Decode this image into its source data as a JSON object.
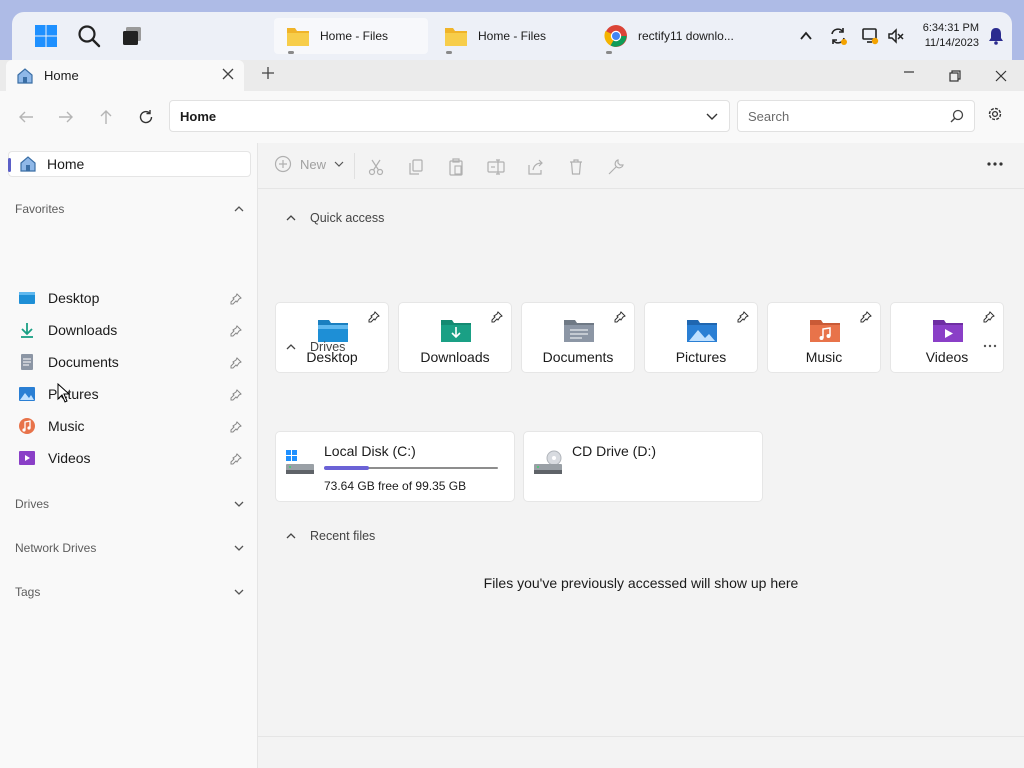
{
  "taskbar": {
    "tasks": [
      {
        "label": "Home - Files",
        "icon": "files-folder-icon"
      },
      {
        "label": "Home - Files",
        "icon": "files-folder-icon"
      },
      {
        "label": "rectify11 downlo...",
        "icon": "chrome-icon"
      }
    ],
    "time": "6:34:31 PM",
    "date": "11/14/2023"
  },
  "window": {
    "tab_title": "Home",
    "address": "Home",
    "search_placeholder": "Search"
  },
  "sidebar": {
    "home_label": "Home",
    "favorites_label": "Favorites",
    "favorites": [
      {
        "label": "Desktop",
        "icon": "desktop-icon"
      },
      {
        "label": "Downloads",
        "icon": "downloads-icon"
      },
      {
        "label": "Documents",
        "icon": "documents-icon"
      },
      {
        "label": "Pictures",
        "icon": "pictures-icon"
      },
      {
        "label": "Music",
        "icon": "music-icon"
      },
      {
        "label": "Videos",
        "icon": "videos-icon"
      }
    ],
    "sections": [
      "Drives",
      "Network Drives",
      "Tags"
    ]
  },
  "toolbar": {
    "new_label": "New"
  },
  "main": {
    "quick_access_label": "Quick access",
    "quick_access": [
      {
        "label": "Desktop",
        "icon": "desktop-folder-icon"
      },
      {
        "label": "Downloads",
        "icon": "downloads-folder-icon"
      },
      {
        "label": "Documents",
        "icon": "documents-folder-icon"
      },
      {
        "label": "Pictures",
        "icon": "pictures-folder-icon"
      },
      {
        "label": "Music",
        "icon": "music-folder-icon"
      },
      {
        "label": "Videos",
        "icon": "videos-folder-icon"
      }
    ],
    "drives_label": "Drives",
    "drives": [
      {
        "name": "Local Disk (C:)",
        "free": "73.64 GB free of 99.35 GB",
        "used_fraction": 0.259
      },
      {
        "name": "CD Drive (D:)"
      }
    ],
    "recent_label": "Recent files",
    "recent_empty": "Files you've previously accessed will show up here"
  },
  "colors": {
    "accent": "#5b5fc7",
    "drive_fill": "#6b62d6",
    "desktop_blue": "#1e8fd6",
    "downloads_teal": "#1aa085",
    "pictures_blue": "#2a7fd4",
    "music_orange": "#e8734a",
    "videos_purple": "#8a3fc7"
  }
}
